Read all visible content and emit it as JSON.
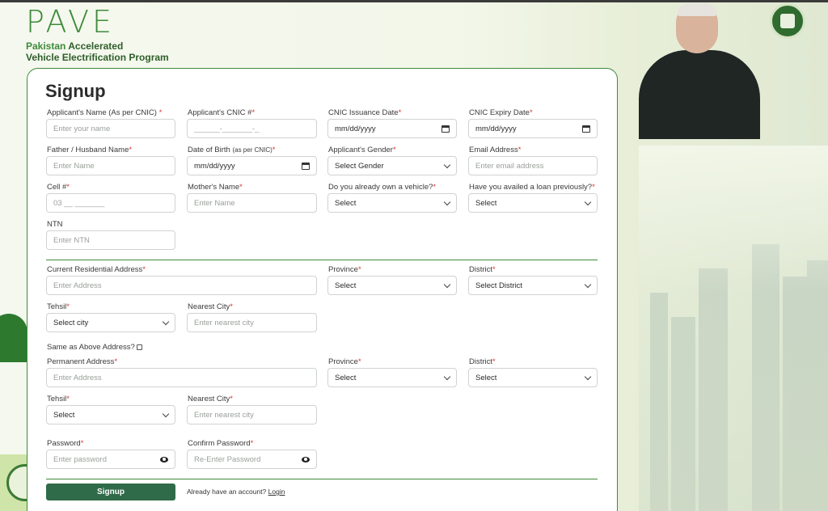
{
  "brand": {
    "logo_text": "PAVE",
    "tagline_line1_green": "Pakistan",
    "tagline_line1_rest": " Accelerated",
    "tagline_line2": "Vehicle Electrification Program"
  },
  "form": {
    "title": "Signup",
    "applicant_name": {
      "label": "Applicant's Name (As per CNIC) ",
      "req": "*",
      "placeholder": "Enter your name"
    },
    "applicant_cnic": {
      "label": "Applicant's CNIC #",
      "req": "*",
      "placeholder": "______-_______-_"
    },
    "cnic_issue": {
      "label": "CNIC Issuance Date",
      "req": "*",
      "value": "mm/dd/yyyy"
    },
    "cnic_expiry": {
      "label": "CNIC Expiry Date",
      "req": "*",
      "value": "mm/dd/yyyy"
    },
    "father_name": {
      "label": "Father / Husband Name",
      "req": "*",
      "placeholder": "Enter Name"
    },
    "dob": {
      "label": "Date of Birth ",
      "label_small": "(as per CNIC)",
      "req": "*",
      "value": "mm/dd/yyyy"
    },
    "gender": {
      "label": "Applicant's Gender",
      "req": "*",
      "value": "Select Gender"
    },
    "email": {
      "label": "Email Address",
      "req": "*",
      "placeholder": "Enter email address"
    },
    "cell": {
      "label": "Cell #",
      "req": "*",
      "placeholder": "03 __ _______"
    },
    "mother_name": {
      "label": "Mother's Name",
      "req": "*",
      "placeholder": "Enter Name"
    },
    "own_vehicle": {
      "label": "Do you already own a vehicle?",
      "req": "*",
      "value": "Select"
    },
    "loan_prev": {
      "label": "Have you availed a loan previously?",
      "req": "*",
      "value": "Select"
    },
    "ntn": {
      "label": "NTN",
      "placeholder": "Enter NTN"
    },
    "current_address": {
      "label": "Current Residential Address",
      "req": "*",
      "placeholder": "Enter Address"
    },
    "province1": {
      "label": "Province",
      "req": "*",
      "value": "Select"
    },
    "district1": {
      "label": "District",
      "req": "*",
      "value": "Select District"
    },
    "tehsil1": {
      "label": "Tehsil",
      "req": "*",
      "value": "Select city"
    },
    "city1": {
      "label": "Nearest City",
      "req": "*",
      "placeholder": "Enter nearest city"
    },
    "same_as_above": {
      "label": "Same as Above Address?"
    },
    "permanent_address": {
      "label": "Permanent Address",
      "req": "*",
      "placeholder": "Enter Address"
    },
    "province2": {
      "label": "Province",
      "req": "*",
      "value": "Select"
    },
    "district2": {
      "label": "District",
      "req": "*",
      "value": "Select"
    },
    "tehsil2": {
      "label": "Tehsil",
      "req": "*",
      "value": "Select"
    },
    "city2": {
      "label": "Nearest City",
      "req": "*",
      "placeholder": "Enter nearest city"
    },
    "password": {
      "label": "Password",
      "req": "*",
      "placeholder": "Enter password"
    },
    "confirm_password": {
      "label": "Confirm Password",
      "req": "*",
      "placeholder": "Re-Enter Password"
    },
    "signup_button": "Signup",
    "have_account": "Already have an account? ",
    "login_link": "Login"
  },
  "colors": {
    "brand_green": "#3e8a3a",
    "button_green": "#2f6b48",
    "required": "#dd3333"
  }
}
